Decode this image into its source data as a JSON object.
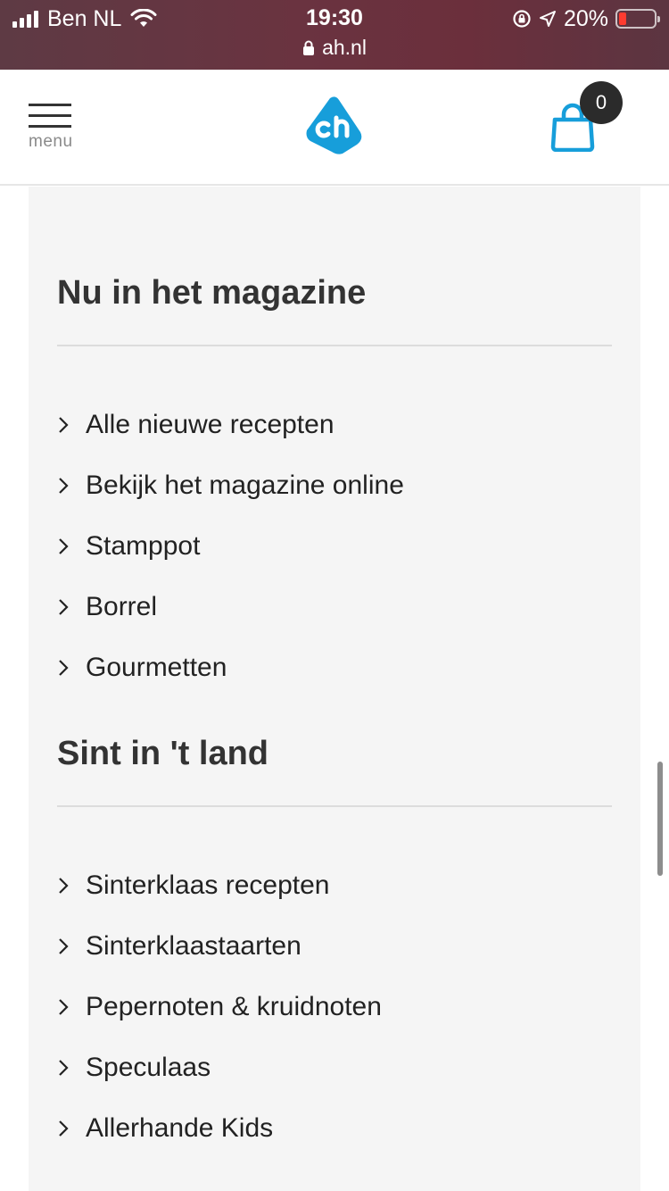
{
  "status_bar": {
    "carrier": "Ben NL",
    "time": "19:30",
    "url": "ah.nl",
    "battery_percent": "20%",
    "battery_level": 0.2,
    "signal_bars": 4,
    "icons": [
      "signal-icon",
      "wifi-icon",
      "lock-icon",
      "orientation-lock-icon",
      "location-icon",
      "battery-icon"
    ]
  },
  "header": {
    "menu_label": "menu",
    "cart_count": "0",
    "brand_color": "#179eda",
    "icons": [
      "hamburger-icon",
      "ah-logo",
      "shopping-bag-icon"
    ]
  },
  "sections": [
    {
      "title": "Nu in het magazine",
      "links": [
        "Alle nieuwe recepten",
        "Bekijk het magazine online",
        "Stamppot",
        "Borrel",
        "Gourmetten"
      ]
    },
    {
      "title": "Sint in 't land",
      "links": [
        "Sinterklaas recepten",
        "Sinterklaastaarten",
        "Pepernoten & kruidnoten",
        "Speculaas",
        "Allerhande Kids"
      ]
    }
  ],
  "colors": {
    "status_bar_bg": "#6b2f3c",
    "panel_bg": "#f5f5f5",
    "text": "#222222",
    "divider": "#dcdcdc"
  }
}
